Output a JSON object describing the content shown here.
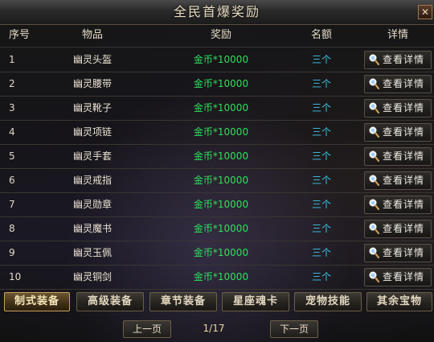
{
  "window": {
    "title": "全民首爆奖励",
    "close_label": "✕"
  },
  "columns": {
    "no": "序号",
    "item": "物品",
    "reward": "奖励",
    "quota": "名额",
    "detail": "详情"
  },
  "rows": [
    {
      "no": "1",
      "item": "幽灵头盔",
      "reward": "金币*10000",
      "quota": "三个",
      "detail": "查看详情"
    },
    {
      "no": "2",
      "item": "幽灵腰带",
      "reward": "金币*10000",
      "quota": "三个",
      "detail": "查看详情"
    },
    {
      "no": "3",
      "item": "幽灵靴子",
      "reward": "金币*10000",
      "quota": "三个",
      "detail": "查看详情"
    },
    {
      "no": "4",
      "item": "幽灵项链",
      "reward": "金币*10000",
      "quota": "三个",
      "detail": "查看详情"
    },
    {
      "no": "5",
      "item": "幽灵手套",
      "reward": "金币*10000",
      "quota": "三个",
      "detail": "查看详情"
    },
    {
      "no": "6",
      "item": "幽灵戒指",
      "reward": "金币*10000",
      "quota": "三个",
      "detail": "查看详情"
    },
    {
      "no": "7",
      "item": "幽灵勋章",
      "reward": "金币*10000",
      "quota": "三个",
      "detail": "查看详情"
    },
    {
      "no": "8",
      "item": "幽灵魔书",
      "reward": "金币*10000",
      "quota": "三个",
      "detail": "查看详情"
    },
    {
      "no": "9",
      "item": "幽灵玉佩",
      "reward": "金币*10000",
      "quota": "三个",
      "detail": "查看详情"
    },
    {
      "no": "10",
      "item": "幽灵铜剑",
      "reward": "金币*10000",
      "quota": "三个",
      "detail": "查看详情"
    }
  ],
  "tabs": [
    {
      "label": "制式装备",
      "active": true
    },
    {
      "label": "高级装备",
      "active": false
    },
    {
      "label": "章节装备",
      "active": false
    },
    {
      "label": "星座魂卡",
      "active": false
    },
    {
      "label": "宠物技能",
      "active": false
    },
    {
      "label": "其余宝物",
      "active": false
    }
  ],
  "pagination": {
    "prev_label": "上一页",
    "next_label": "下一页",
    "indicator": "1/17"
  },
  "colors": {
    "reward_text": "#2ee05a",
    "quota_text": "#3cc8e8",
    "active_tab_border": "#c8a060"
  },
  "icons": {
    "detail": "magnifier-icon",
    "close": "close-icon"
  }
}
